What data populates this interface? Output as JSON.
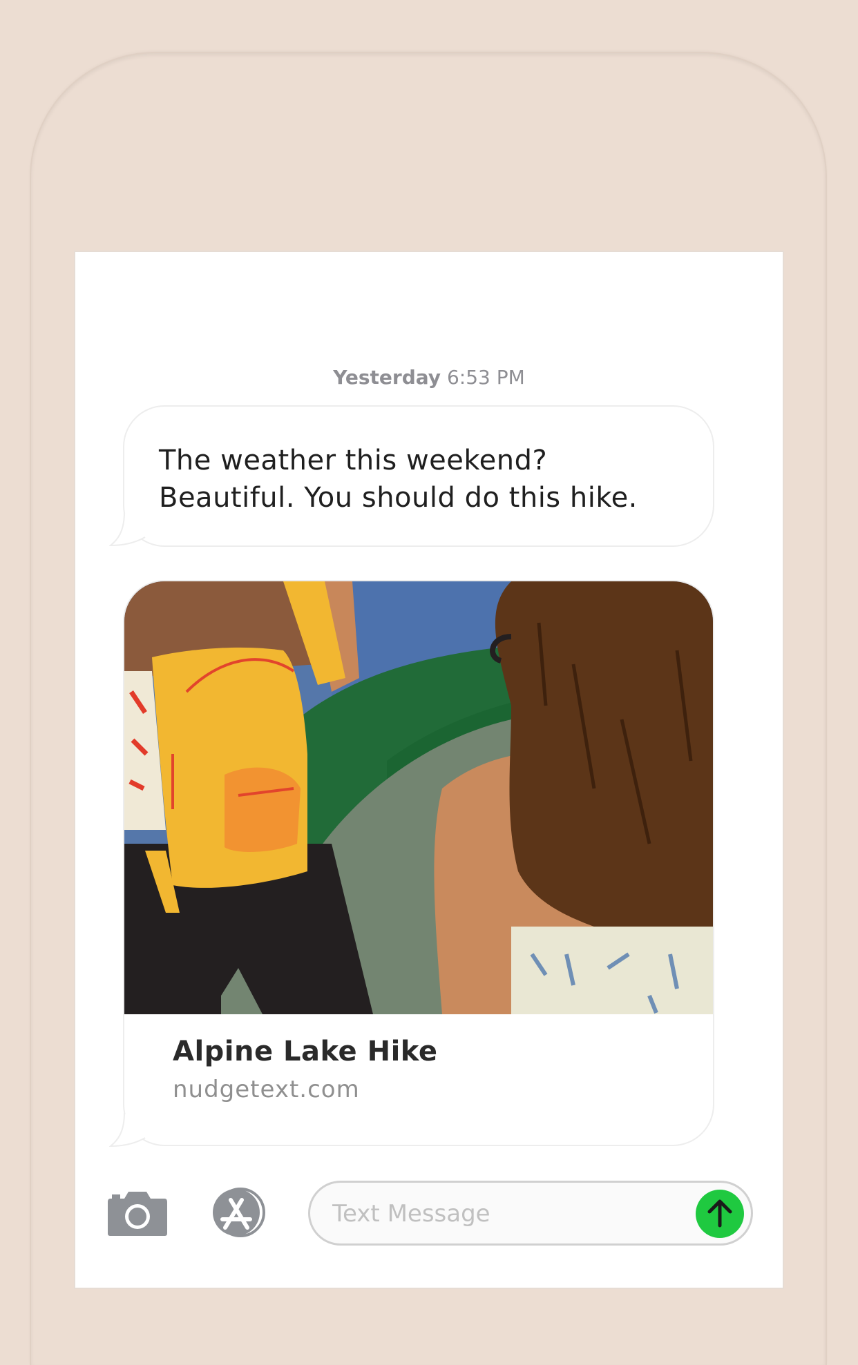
{
  "conversation": {
    "timestamp_day": "Yesterday",
    "timestamp_time": "6:53 PM",
    "message_line1": "The weather this weekend?",
    "message_line2": "Beautiful. You should do this hike."
  },
  "link_preview": {
    "title": "Alpine Lake Hike",
    "domain": "nudgetext.com",
    "image": "illustration of two hikers with a yellow backpack looking at green hills and blue sky"
  },
  "input_bar": {
    "camera_icon": "camera-icon",
    "apps_icon": "app-store-icon",
    "placeholder": "Text Message",
    "send_icon": "arrow-up-icon"
  },
  "colors": {
    "background": "#ecddd2",
    "send_button": "#1fc940",
    "icon_gray": "#8e9196"
  }
}
